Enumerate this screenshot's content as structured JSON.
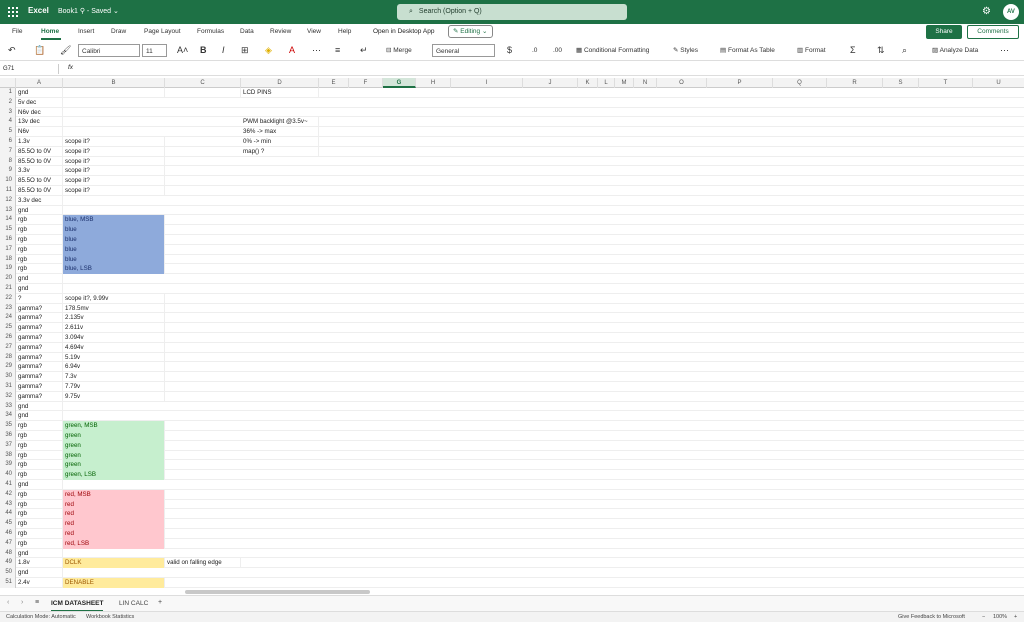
{
  "titlebar": {
    "app": "Excel",
    "doc": "Book1",
    "saved": "Saved",
    "search_placeholder": "Search (Option + Q)",
    "avatar": "AV"
  },
  "tabs": [
    "File",
    "Home",
    "Insert",
    "Draw",
    "Page Layout",
    "Formulas",
    "Data",
    "Review",
    "View",
    "Help"
  ],
  "open_desktop": "Open in Desktop App",
  "editing": "Editing",
  "share": "Share",
  "comments": "Comments",
  "ribbon": {
    "font": "Calibri",
    "size": "11",
    "merge": "Merge",
    "number_format": "General",
    "conditional": "Conditional Formatting",
    "styles": "Styles",
    "format_as_table": "Format As Table",
    "format": "Format",
    "analyze": "Analyze Data"
  },
  "namebox": "G71",
  "fx": "fx",
  "columns": [
    "A",
    "B",
    "C",
    "D",
    "E",
    "F",
    "G",
    "H",
    "I",
    "J",
    "K",
    "L",
    "M",
    "N",
    "O",
    "P",
    "Q",
    "R",
    "S",
    "T",
    "U"
  ],
  "selected_column": "G",
  "rows": [
    {
      "n": "1",
      "A": "gnd",
      "B": "",
      "C": "",
      "D": "LCD PINS"
    },
    {
      "n": "2",
      "A": "5v dec"
    },
    {
      "n": "3",
      "A": "N6v dec"
    },
    {
      "n": "4",
      "A": "13v dec",
      "D": "PWM backlight @3.5v~"
    },
    {
      "n": "5",
      "A": "N6v",
      "D": "36% -> max"
    },
    {
      "n": "6",
      "A": "1.3v",
      "B": "scope it?",
      "D": "0% -> min"
    },
    {
      "n": "7",
      "A": "85.5O to 0V",
      "B": "scope it?",
      "D": "map() ?"
    },
    {
      "n": "8",
      "A": "85.5O to 0V",
      "B": "scope it?"
    },
    {
      "n": "9",
      "A": "3.3v",
      "B": "scope it?"
    },
    {
      "n": "10",
      "A": "85.5O to 0V",
      "B": "scope it?"
    },
    {
      "n": "11",
      "A": "85.5O to 0V",
      "B": "scope it?"
    },
    {
      "n": "12",
      "A": "3.3v dec"
    },
    {
      "n": "13",
      "A": "gnd"
    },
    {
      "n": "14",
      "A": "rgb",
      "B": "blue, MSB",
      "fill": "blue"
    },
    {
      "n": "15",
      "A": "rgb",
      "B": "blue",
      "fill": "blue"
    },
    {
      "n": "16",
      "A": "rgb",
      "B": "blue",
      "fill": "blue"
    },
    {
      "n": "17",
      "A": "rgb",
      "B": "blue",
      "fill": "blue"
    },
    {
      "n": "18",
      "A": "rgb",
      "B": "blue",
      "fill": "blue"
    },
    {
      "n": "19",
      "A": "rgb",
      "B": "blue, LSB",
      "fill": "blue"
    },
    {
      "n": "20",
      "A": "gnd"
    },
    {
      "n": "21",
      "A": "gnd"
    },
    {
      "n": "22",
      "A": "?",
      "B": "scope it?, 9.99v"
    },
    {
      "n": "23",
      "A": "gamma?",
      "B": "178.5mv"
    },
    {
      "n": "24",
      "A": "gamma?",
      "B": "2.135v"
    },
    {
      "n": "25",
      "A": "gamma?",
      "B": "2.611v"
    },
    {
      "n": "26",
      "A": "gamma?",
      "B": "3.094v"
    },
    {
      "n": "27",
      "A": "gamma?",
      "B": "4.694v"
    },
    {
      "n": "28",
      "A": "gamma?",
      "B": "5.19v"
    },
    {
      "n": "29",
      "A": "gamma?",
      "B": "6.94v"
    },
    {
      "n": "30",
      "A": "gamma?",
      "B": "7.3v"
    },
    {
      "n": "31",
      "A": "gamma?",
      "B": "7.79v"
    },
    {
      "n": "32",
      "A": "gamma?",
      "B": "9.75v"
    },
    {
      "n": "33",
      "A": "gnd"
    },
    {
      "n": "34",
      "A": "gnd"
    },
    {
      "n": "35",
      "A": "rgb",
      "B": "green, MSB",
      "fill": "green"
    },
    {
      "n": "36",
      "A": "rgb",
      "B": "green",
      "fill": "green"
    },
    {
      "n": "37",
      "A": "rgb",
      "B": "green",
      "fill": "green"
    },
    {
      "n": "38",
      "A": "rgb",
      "B": "green",
      "fill": "green"
    },
    {
      "n": "39",
      "A": "rgb",
      "B": "green",
      "fill": "green"
    },
    {
      "n": "40",
      "A": "rgb",
      "B": "green, LSB",
      "fill": "green"
    },
    {
      "n": "41",
      "A": "gnd"
    },
    {
      "n": "42",
      "A": "rgb",
      "B": "red, MSB",
      "fill": "red"
    },
    {
      "n": "43",
      "A": "rgb",
      "B": "red",
      "fill": "red"
    },
    {
      "n": "44",
      "A": "rgb",
      "B": "red",
      "fill": "red"
    },
    {
      "n": "45",
      "A": "rgb",
      "B": "red",
      "fill": "red"
    },
    {
      "n": "46",
      "A": "rgb",
      "B": "red",
      "fill": "red"
    },
    {
      "n": "47",
      "A": "rgb",
      "B": "red, LSB",
      "fill": "red"
    },
    {
      "n": "48",
      "A": "gnd"
    },
    {
      "n": "49",
      "A": "1.8v",
      "B": "DCLK",
      "C": "valid on falling edge",
      "fill": "yellow"
    },
    {
      "n": "50",
      "A": "gnd"
    },
    {
      "n": "51",
      "A": "2.4v",
      "B": "DENABLE",
      "fill": "yellow"
    }
  ],
  "sheets": [
    "ICM DATASHEET",
    "LIN CALC"
  ],
  "status": {
    "calc_mode": "Calculation Mode: Automatic",
    "stats": "Workbook Statistics",
    "feedback": "Give Feedback to Microsoft",
    "zoom": "100%"
  },
  "colors": {
    "accent": "#1e7145",
    "blue_fill": "#8eaadb",
    "green_fill": "#c6efce",
    "red_fill": "#ffc7ce",
    "yellow_fill": "#ffeb9c"
  }
}
